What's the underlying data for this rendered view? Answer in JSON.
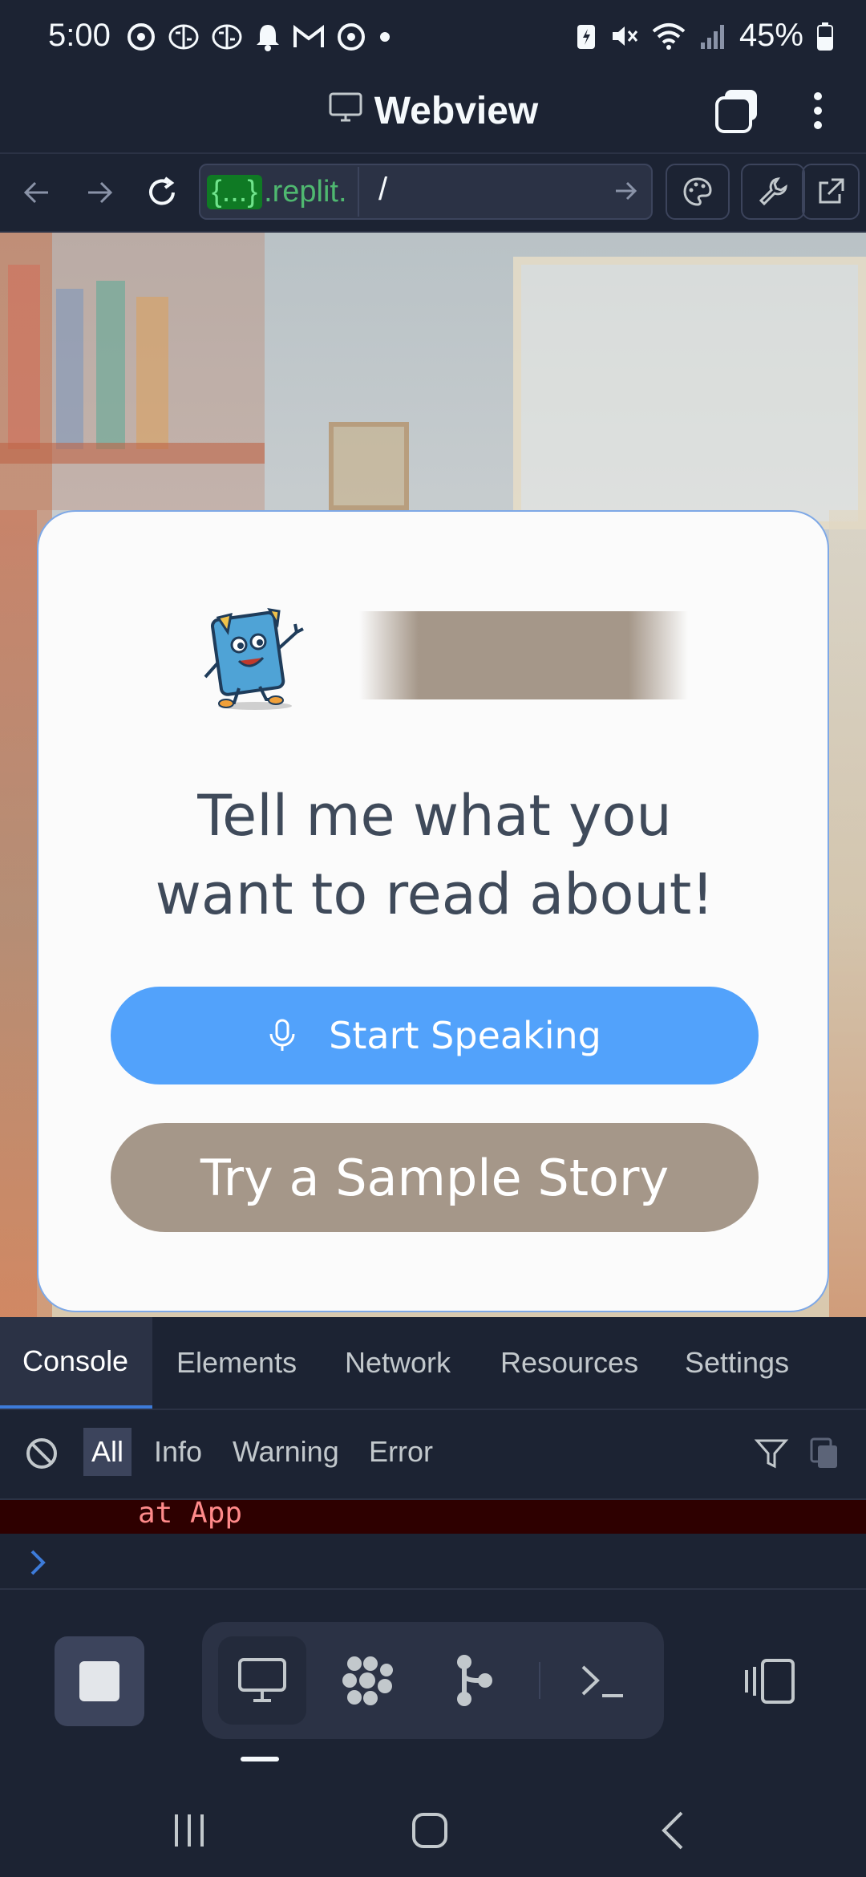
{
  "status_bar": {
    "time": "5:00",
    "battery_pct": "45%",
    "notification_icons": [
      "chrome-icon",
      "brain-icon",
      "brain-icon",
      "bell-icon",
      "gmail-icon",
      "chrome-icon",
      "dot-icon"
    ],
    "system_icons": [
      "battery-saver-icon",
      "mute-icon",
      "wifi-icon",
      "signal-icon",
      "battery-icon"
    ]
  },
  "header": {
    "title": "Webview",
    "icon": "monitor-icon"
  },
  "navbar": {
    "url_host_prefix": "{...}",
    "url_host_suffix": ".replit.",
    "url_path": "/",
    "icons": [
      "back-arrow-icon",
      "forward-arrow-icon",
      "reload-icon",
      "go-arrow-icon",
      "palette-icon",
      "wrench-icon",
      "external-link-icon"
    ]
  },
  "webview": {
    "headline_line1": "Tell me what you",
    "headline_line2": "want to read about!",
    "speak_button": "Start Speaking",
    "sample_button": "Try a Sample Story",
    "accent": "#52a2fb",
    "secondary": "#a59789"
  },
  "devtools": {
    "tabs": [
      "Console",
      "Elements",
      "Network",
      "Resources",
      "Settings"
    ],
    "active_tab": "Console",
    "filters": [
      "All",
      "Info",
      "Warning",
      "Error"
    ],
    "active_filter": "All",
    "log_line": "at App"
  },
  "bottom_bar": {
    "tools": [
      "monitor-icon",
      "workspace-icon",
      "git-icon",
      "terminal-icon"
    ]
  }
}
